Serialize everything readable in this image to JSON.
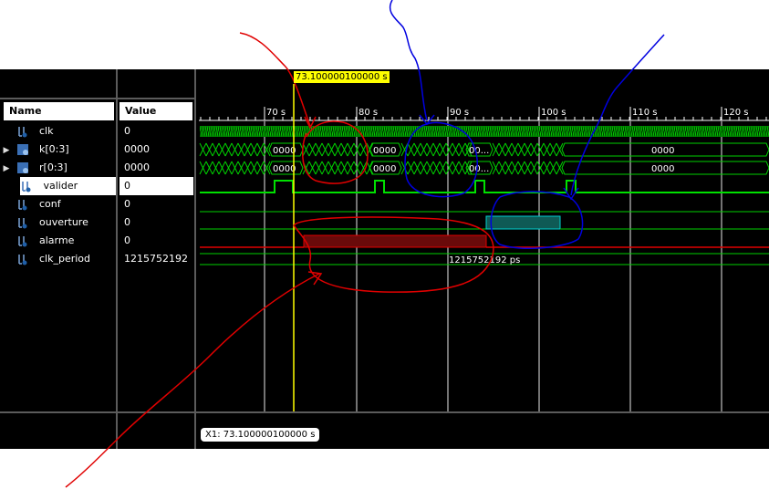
{
  "cursor": {
    "label": "73.100000100000 s",
    "readout": "X1: 73.100000100000 s"
  },
  "columns": {
    "name_header": "Name",
    "value_header": "Value"
  },
  "signals": [
    {
      "name": "clk",
      "value": "0",
      "kind": "bit",
      "expandable": false
    },
    {
      "name": "k[0:3]",
      "value": "0000",
      "kind": "bus",
      "expandable": true
    },
    {
      "name": "r[0:3]",
      "value": "0000",
      "kind": "bus",
      "expandable": true
    },
    {
      "name": "valider",
      "value": "0",
      "kind": "bit",
      "expandable": false,
      "selected": true
    },
    {
      "name": "conf",
      "value": "0",
      "kind": "bit",
      "expandable": false
    },
    {
      "name": "ouverture",
      "value": "0",
      "kind": "bit",
      "expandable": false
    },
    {
      "name": "alarme",
      "value": "0",
      "kind": "bit",
      "expandable": false
    },
    {
      "name": "clk_period",
      "value": "1215752192",
      "kind": "bus",
      "expandable": false
    }
  ],
  "timeline": {
    "ticks": [
      "70 s",
      "80 s",
      "90 s",
      "100 s",
      "110 s",
      "120 s"
    ]
  },
  "bus_labels": {
    "k": [
      "0000",
      "0000",
      "00...",
      "0000"
    ],
    "r": [
      "0000",
      "0000",
      "00...",
      "0000"
    ],
    "clk_period": "1215752192 ps"
  },
  "colors": {
    "wave_green": "#00e000",
    "ouverture_fill": "#0f5a55",
    "alarme_fill": "#6a0a0a",
    "annotation_red": "#e00000",
    "annotation_blue": "#0000e0"
  },
  "icons": {
    "bit": "signal-bit-icon",
    "bus": "signal-bus-icon",
    "expand": "expand-arrow-icon"
  }
}
